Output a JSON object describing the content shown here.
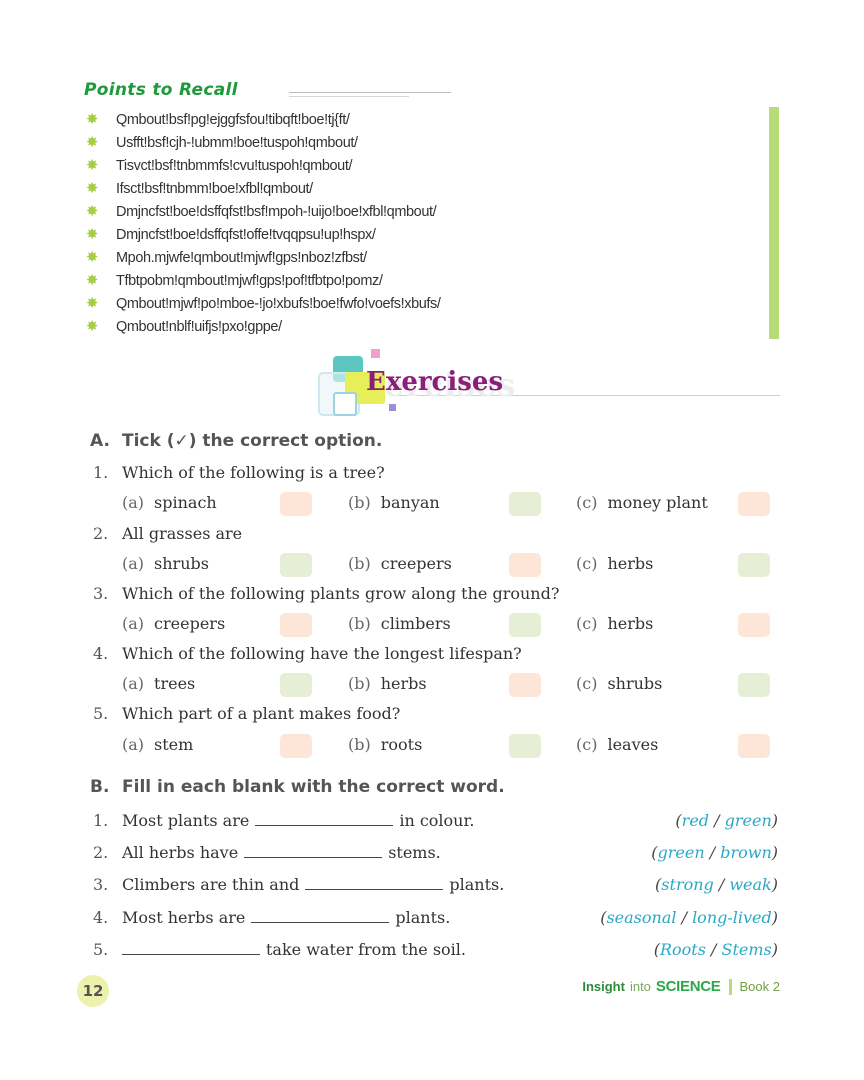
{
  "recall": {
    "title": "Points to Recall",
    "items": [
      "Qmbout!bsf!pg!ejggfsfou!tibqft!boe!tj{ft/",
      "Usfft!bsf!cjh-!ubmm!boe!tuspoh!qmbout/",
      "Tisvct!bsf!tnbmmfs!cvu!tuspoh!qmbout/",
      "Ifsct!bsf!tnbmm!boe!xfbl!qmbout/",
      "Dmjncfst!boe!dsffqfst!bsf!mpoh-!uijo!boe!xfbl!qmbout/",
      "Dmjncfst!boe!dsffqfst!offe!tvqqpsu!up!hspx/",
      "Mpoh.mjwfe!qmbout!mjwf!gps!nboz!zfbst/",
      "Tfbtpobm!qmbout!mjwf!gps!pof!tfbtpo!pomz/",
      "Qmbout!mjwf!po!mboe-!jo!xbufs!boe!fwfo!voefs!xbufs/",
      "Qmbout!nblf!uifjs!pxo!gppe/"
    ]
  },
  "exercises": {
    "title": "Exercises",
    "ghost": "ercises"
  },
  "sectionA": {
    "letter": "A.",
    "heading": "Tick (✓) the correct option.",
    "questions": [
      {
        "num": "1.",
        "text": "Which of the following is a tree?",
        "options": [
          {
            "label": "(a)",
            "text": "spinach"
          },
          {
            "label": "(b)",
            "text": "banyan"
          },
          {
            "label": "(c)",
            "text": "money plant"
          }
        ]
      },
      {
        "num": "2.",
        "text": "All grasses are",
        "options": [
          {
            "label": "(a)",
            "text": "shrubs"
          },
          {
            "label": "(b)",
            "text": "creepers"
          },
          {
            "label": "(c)",
            "text": "herbs"
          }
        ]
      },
      {
        "num": "3.",
        "text": "Which of the following plants grow along the ground?",
        "options": [
          {
            "label": "(a)",
            "text": "creepers"
          },
          {
            "label": "(b)",
            "text": "climbers"
          },
          {
            "label": "(c)",
            "text": "herbs"
          }
        ]
      },
      {
        "num": "4.",
        "text": "Which of the following have the longest lifespan?",
        "options": [
          {
            "label": "(a)",
            "text": "trees"
          },
          {
            "label": "(b)",
            "text": "herbs"
          },
          {
            "label": "(c)",
            "text": "shrubs"
          }
        ]
      },
      {
        "num": "5.",
        "text": "Which part of a plant makes food?",
        "options": [
          {
            "label": "(a)",
            "text": "stem"
          },
          {
            "label": "(b)",
            "text": "roots"
          },
          {
            "label": "(c)",
            "text": "leaves"
          }
        ]
      }
    ],
    "box_colors": {
      "peach": "#fde6d8",
      "green": "#e6efd6"
    }
  },
  "sectionB": {
    "letter": "B.",
    "heading": "Fill in each blank with the correct word.",
    "items": [
      {
        "num": "1.",
        "before": "Most plants are",
        "after": "in colour.",
        "c1": "red",
        "c2": "green"
      },
      {
        "num": "2.",
        "before": "All herbs have",
        "after": "stems.",
        "c1": "green",
        "c2": "brown"
      },
      {
        "num": "3.",
        "before": "Climbers are thin and",
        "after": "plants.",
        "c1": "strong",
        "c2": "weak"
      },
      {
        "num": "4.",
        "before": "Most herbs are",
        "after": "plants.",
        "c1": "seasonal",
        "c2": "long-lived"
      },
      {
        "num": "5.",
        "before": "",
        "after": "take water from the soil.",
        "c1": "Roots",
        "c2": "Stems"
      }
    ],
    "slash": "/",
    "open_paren": "(",
    "close_paren": ")"
  },
  "footer": {
    "page_number": "12",
    "insight": "Insight",
    "into": "into",
    "science": "SCIENCE",
    "book": "Book 2"
  },
  "colors": {
    "recall_title": "#1e9a3c",
    "exercises_title": "#8a1f7a",
    "choice_word": "#2aa8c7",
    "side_bar": "#b7dd79"
  }
}
